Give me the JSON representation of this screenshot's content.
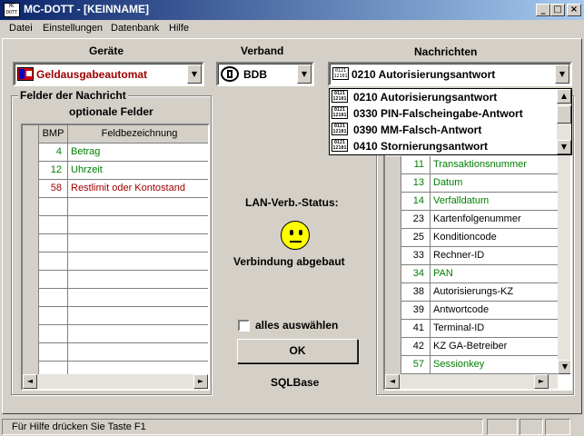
{
  "window": {
    "title": "MC-DOTT - [KEINNAME]",
    "icon_text": "MC\nDOTT",
    "minimize": "_",
    "maximize": "□",
    "close": "×"
  },
  "menu": [
    "Datei",
    "Einstellungen",
    "Datenbank",
    "Hilfe"
  ],
  "headings": {
    "geraete": "Geräte",
    "verband": "Verband",
    "nachrichten": "Nachrichten"
  },
  "combos": {
    "geraete": "Geldausgabeautomat",
    "verband": "BDB",
    "nachrichten": "0210 Autorisierungsantwort"
  },
  "icon_glyph": "0121\n12101",
  "dropdown": {
    "items": [
      "0210 Autorisierungsantwort",
      "0330 PIN-Falscheingabe-Antwort",
      "0390 MM-Falsch-Antwort",
      "0410 Stornierungsantwort"
    ],
    "selected_index": 0
  },
  "felder": {
    "group_label": "Felder der Nachricht",
    "optional_label": "optionale Felder",
    "columns": [
      "BMP",
      "Feldbezeichnung"
    ],
    "rows": [
      {
        "bmp": "4",
        "name": "Betrag",
        "color": "#008000"
      },
      {
        "bmp": "12",
        "name": "Uhrzeit",
        "color": "#008000"
      },
      {
        "bmp": "58",
        "name": "Restlimit oder Kontostand",
        "color": "#a00000"
      }
    ]
  },
  "pflicht": {
    "rows": [
      {
        "bmp": "11",
        "name": "Transaktionsnummer",
        "color": "#008000"
      },
      {
        "bmp": "13",
        "name": "Datum",
        "color": "#008000"
      },
      {
        "bmp": "14",
        "name": "Verfalldatum",
        "color": "#008000"
      },
      {
        "bmp": "23",
        "name": "Kartenfolgenummer",
        "color": "#000000"
      },
      {
        "bmp": "25",
        "name": "Konditioncode",
        "color": "#000000"
      },
      {
        "bmp": "33",
        "name": "Rechner-ID",
        "color": "#000000"
      },
      {
        "bmp": "34",
        "name": "PAN",
        "color": "#008000"
      },
      {
        "bmp": "38",
        "name": "Autorisierungs-KZ",
        "color": "#000000"
      },
      {
        "bmp": "39",
        "name": "Antwortcode",
        "color": "#000000"
      },
      {
        "bmp": "41",
        "name": "Terminal-ID",
        "color": "#000000"
      },
      {
        "bmp": "42",
        "name": "KZ GA-Betreiber",
        "color": "#000000"
      },
      {
        "bmp": "57",
        "name": "Sessionkey",
        "color": "#008000"
      }
    ]
  },
  "center": {
    "lan_status_label": "LAN-Verb.-Status:",
    "connection_status": "Verbindung abgebaut",
    "select_all_label": "alles auswählen",
    "select_all_checked": false,
    "ok_label": "OK",
    "db_label": "SQLBase"
  },
  "scroll_arrows": {
    "left": "◄",
    "right": "►",
    "up": "▲",
    "down": "▼"
  },
  "statusbar": {
    "hint": "Für Hilfe drücken Sie Taste F1"
  }
}
